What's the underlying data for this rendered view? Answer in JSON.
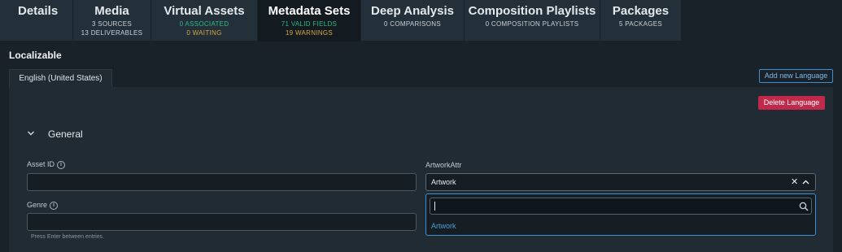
{
  "tabs": [
    {
      "title": "Details",
      "lines": []
    },
    {
      "title": "Media",
      "lines": [
        "3 SOURCES",
        "13 DELIVERABLES"
      ]
    },
    {
      "title": "Virtual Assets",
      "lines": [
        "0 ASSOCIATED",
        "0 WAITING"
      ]
    },
    {
      "title": "Metadata Sets",
      "lines": [
        "71 VALID FIELDS",
        "19 WARNINGS"
      ]
    },
    {
      "title": "Deep Analysis",
      "lines": [
        "0 COMPARISONS"
      ]
    },
    {
      "title": "Composition Playlists",
      "lines": [
        "0 COMPOSITION PLAYLISTS"
      ]
    },
    {
      "title": "Packages",
      "lines": [
        "5 PACKAGES"
      ]
    }
  ],
  "active_tab": "Metadata Sets",
  "section": {
    "title": "Localizable",
    "language_tab": "English (United States)",
    "add_language_label": "Add new Language",
    "delete_language_label": "Delete Language",
    "group_title": "General",
    "group_expanded": true
  },
  "fields": {
    "asset_id": {
      "label": "Asset ID",
      "value": ""
    },
    "genre": {
      "label": "Genre",
      "value": "",
      "hint": "Press Enter between entries."
    },
    "artwork_attr": {
      "label": "ArtworkAttr",
      "value": "Artwork",
      "dropdown_open": true,
      "search_value": "",
      "options": [
        "Artwork"
      ]
    }
  },
  "icons": {
    "info": "info-circle-icon",
    "collapse": "chevron-down-icon",
    "clear": "close-icon",
    "toggle": "chevron-up-icon",
    "search": "search-icon"
  },
  "colors": {
    "accent": "#3f8fd0",
    "danger": "#c0294a",
    "success": "#2fb888",
    "warning": "#d9a640"
  }
}
